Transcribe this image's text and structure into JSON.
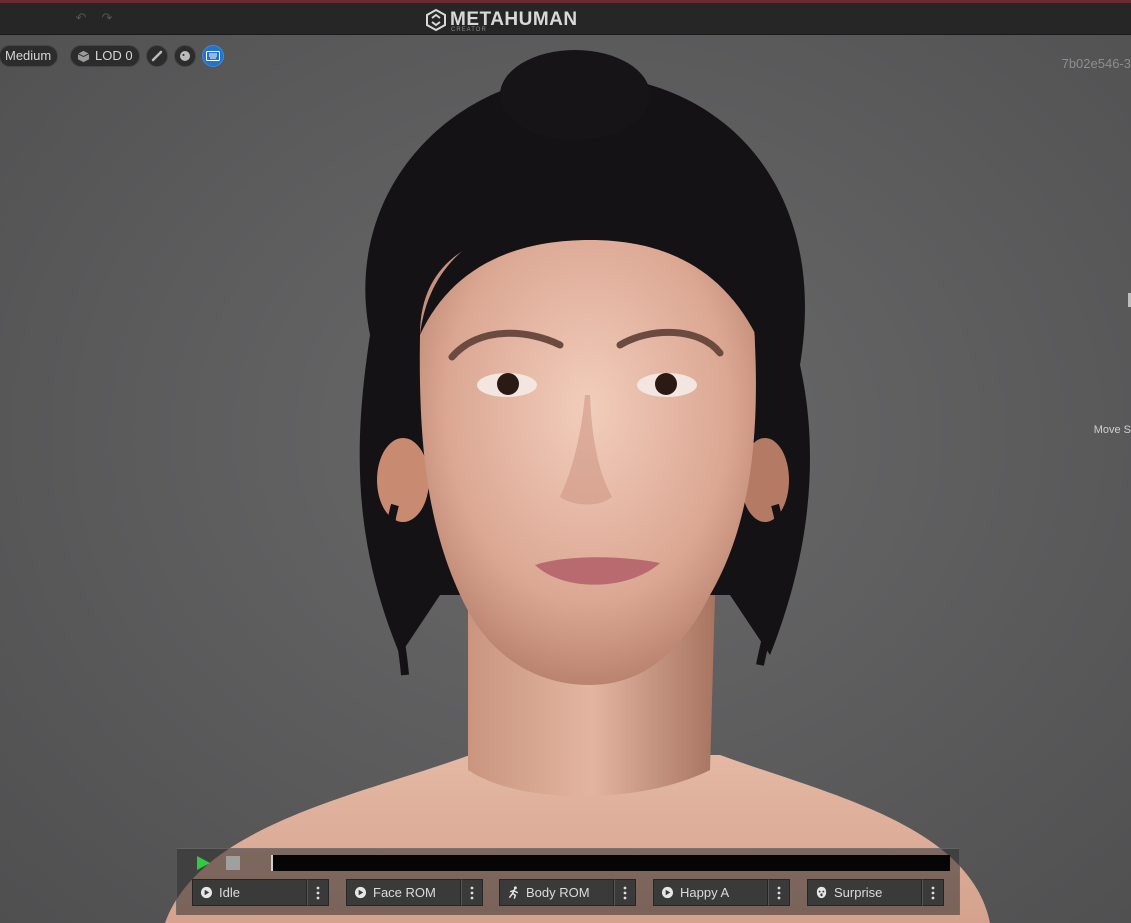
{
  "app": {
    "title": "METAHUMAN",
    "subtitle": "CREATOR"
  },
  "toolbar": {
    "quality_label": "Medium",
    "lod_label": "LOD 0",
    "icons": [
      "brush-icon",
      "head-icon",
      "keyboard-icon"
    ]
  },
  "viewport": {
    "character_id": "7b02e546-3",
    "hint_text": "Move S"
  },
  "player": {
    "animations": [
      {
        "label": "Idle",
        "icon": "play-circle-icon"
      },
      {
        "label": "Face ROM",
        "icon": "play-circle-icon"
      },
      {
        "label": "Body ROM",
        "icon": "running-figure-icon"
      },
      {
        "label": "Happy A",
        "icon": "play-circle-icon"
      },
      {
        "label": "Surprise",
        "icon": "face-icon"
      }
    ],
    "progress": 0
  },
  "colors": {
    "accent": "#2373c9",
    "play": "#2ecc40",
    "background": "#5a5a5b"
  }
}
